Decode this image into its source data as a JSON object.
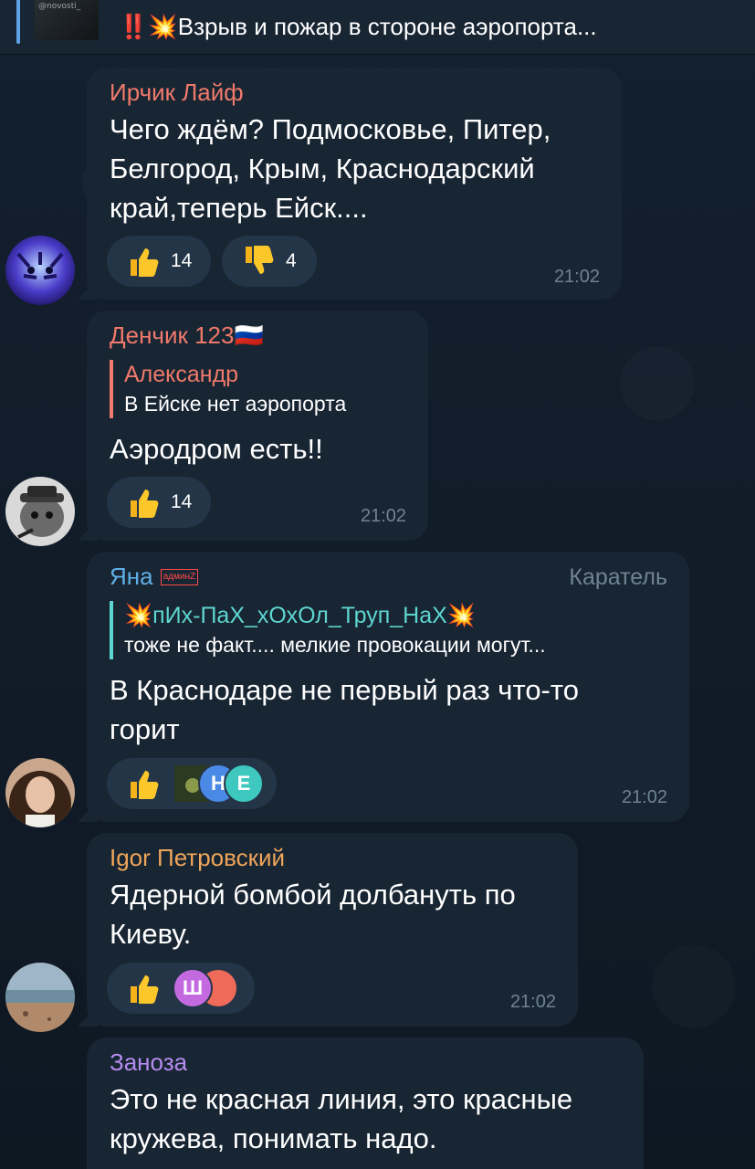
{
  "pinned": {
    "thumb_label": "@novosti_",
    "text": "‼️💥Взрыв и пожар в стороне аэропорта..."
  },
  "colors": {
    "bubble": "#182533",
    "time": "#6f8394",
    "reaction_bg": "#233547"
  },
  "messages": [
    {
      "author": "Ирчик Лайф",
      "author_color": "#f07a6b",
      "lines": [
        "Чего ждём? Подмосковье, Питер,",
        "Белгород, Крым, Краснодарский",
        "край,теперь Ейск...."
      ],
      "reactions": [
        {
          "icon": "thumbs-up-icon",
          "count": "14"
        },
        {
          "icon": "thumbs-down-icon",
          "count": "4"
        }
      ],
      "time": "21:02"
    },
    {
      "author": "Денчик 123🇷🇺",
      "author_color": "#f07a6b",
      "reply": {
        "name": "Александр",
        "text": "В Ейске нет аэропорта",
        "color": "#f07a6b"
      },
      "lines": [
        "Аэродром есть!!"
      ],
      "reactions": [
        {
          "icon": "thumbs-up-icon",
          "count": "14"
        }
      ],
      "time": "21:02"
    },
    {
      "author": "Яна",
      "author_badge": "админZ",
      "author_color": "#5fb0e8",
      "rank": "Каратель",
      "reply": {
        "name": "💥пИх-ПаХ_хОхОл_Труп_НаХ💥",
        "text": "тоже не факт.... мелкие провокации могут...",
        "color": "#5ed6d0"
      },
      "lines": [
        "В Краснодаре не первый раз что-то",
        "горит"
      ],
      "reactions": [
        {
          "icon": "thumbs-up-icon",
          "avatars": [
            "",
            "Н",
            "Е"
          ]
        }
      ],
      "time": "21:02"
    },
    {
      "author": "Igor Петровский",
      "author_color": "#f0a65a",
      "lines": [
        "Ядерной бомбой долбануть по",
        "Киеву."
      ],
      "reactions": [
        {
          "icon": "thumbs-up-icon",
          "avatars": [
            "Ш",
            ""
          ]
        }
      ],
      "time": "21:02"
    },
    {
      "author": "Заноза",
      "author_color": "#b68cf0",
      "lines": [
        "Это не красная линия, это красные",
        "кружева, понимать надо."
      ]
    }
  ]
}
